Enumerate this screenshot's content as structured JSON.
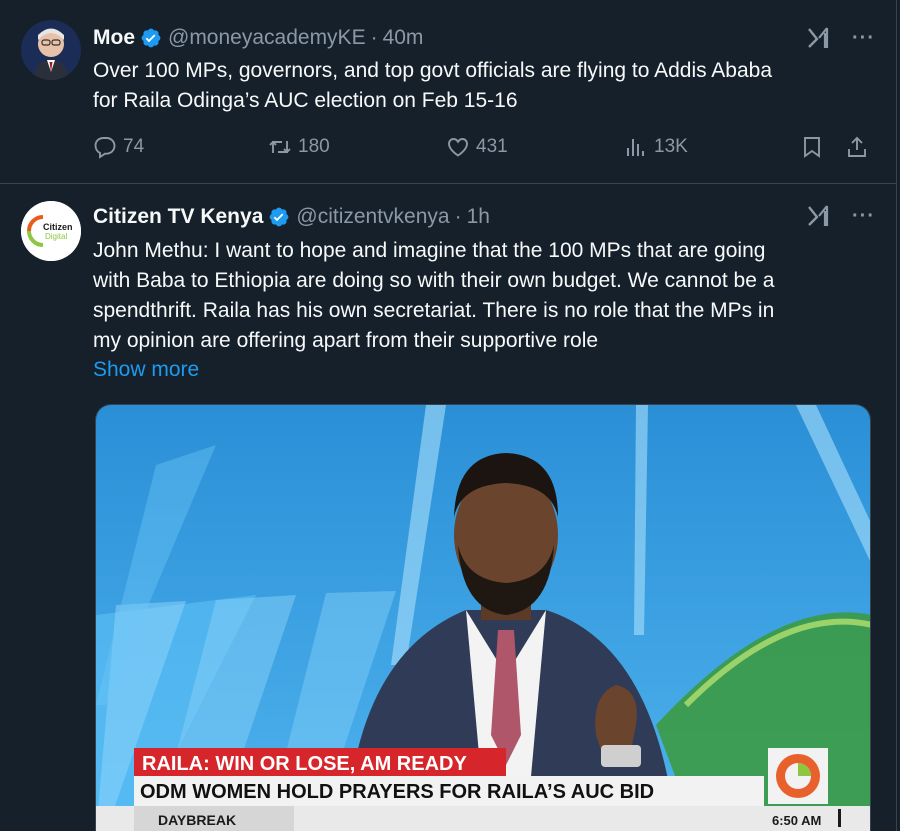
{
  "tweets": [
    {
      "name": "Moe",
      "handle": "@moneyacademyKE",
      "separator": "·",
      "time": "40m",
      "lines": [
        "Over 100 MPs, governors, and top govt officials are flying to Addis Ababa",
        "for Raila Odinga’s AUC election on Feb 15-16"
      ],
      "actions": {
        "replies": "74",
        "reposts": "180",
        "likes": "431",
        "views": "13K"
      }
    },
    {
      "name": "Citizen TV Kenya",
      "handle": "@citizentvkenya",
      "separator": "·",
      "time": "1h",
      "avatar_text": [
        "Citizen",
        "Digital"
      ],
      "lines": [
        "John Methu: I want to hope and imagine that the 100 MPs that are going",
        "with Baba to Ethiopia are doing so with their own budget. We cannot be a",
        "spendthrift. Raila has his own secretariat. There is no role that the MPs in",
        "my opinion are offering apart from their supportive role"
      ],
      "show_more": "Show more",
      "media": {
        "headline_top": "RAILA: WIN OR LOSE, AM READY",
        "headline_main": "ODM WOMEN HOLD PRAYERS FOR RAILA’S AUC BID",
        "show_name": "DAYBREAK",
        "clock": "6:50 AM"
      }
    }
  ],
  "icons": {
    "verified": "verified-badge-icon",
    "grok": "grok-icon",
    "more": "more-icon",
    "reply": "reply-icon",
    "repost": "repost-icon",
    "like": "like-icon",
    "views": "views-icon",
    "bookmark": "bookmark-icon",
    "share": "share-icon"
  },
  "colors": {
    "background": "#15202b",
    "accent": "#1d9bf0",
    "secondary_text": "#8b98a5",
    "divider": "#38444d",
    "banner_red": "#d6262c"
  }
}
